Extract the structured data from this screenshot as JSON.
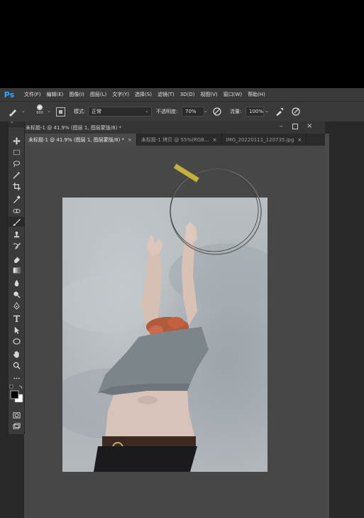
{
  "app": {
    "logo": "Ps"
  },
  "menu": [
    "文件(F)",
    "编辑(E)",
    "图像(I)",
    "图层(L)",
    "文字(Y)",
    "选择(S)",
    "滤镜(T)",
    "3D(D)",
    "视图(V)",
    "窗口(W)",
    "帮助(H)"
  ],
  "options": {
    "brush_size": "600",
    "mode_label": "模式:",
    "mode_value": "正常",
    "opacity_label": "不透明度:",
    "opacity_value": "70%",
    "flow_label": "流量:",
    "flow_value": "100%"
  },
  "document": {
    "title": "未标题-1 @ 41.9% (图层 1, 图层蒙版/8) *",
    "tabs": [
      {
        "label": "未标题-1 @ 41.9% (图层 1, 图层蒙版/8) *",
        "active": true
      },
      {
        "label": "未标题-1 拷贝 @ 55%(RGB...",
        "active": false
      },
      {
        "label": "IMG_20220111_120735.jpg",
        "active": false
      }
    ]
  },
  "tools": [
    "move-icon",
    "marquee-icon",
    "lasso-icon",
    "magic-wand-icon",
    "crop-icon",
    "eyedropper-icon",
    "healing-brush-icon",
    "brush-icon",
    "clone-stamp-icon",
    "history-brush-icon",
    "eraser-icon",
    "gradient-icon",
    "blur-icon",
    "dodge-icon",
    "pen-icon",
    "type-icon",
    "path-selection-icon",
    "ellipse-icon",
    "hand-icon",
    "zoom-icon",
    "more-tools-icon",
    "foreground-background-colors",
    "quick-mask-icon",
    "screen-mode-icon"
  ],
  "colors": {
    "accent": "#31a8ff",
    "panel": "#3a3a3a",
    "canvas_bg": "#474747",
    "foreground": "#000000",
    "background": "#ffffff"
  }
}
